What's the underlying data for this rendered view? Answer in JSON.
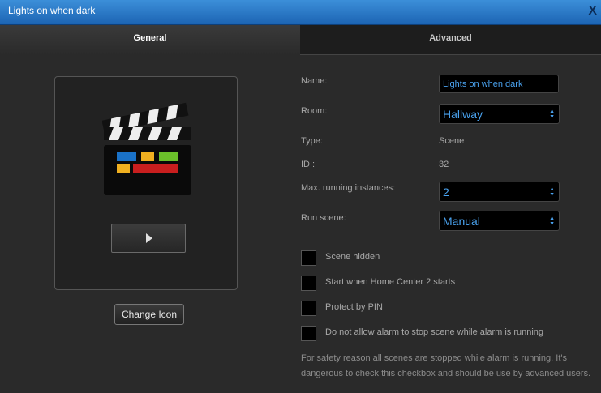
{
  "window": {
    "title": "Lights on when dark",
    "close_label": "X"
  },
  "tabs": [
    {
      "label": "General"
    },
    {
      "label": "Advanced"
    }
  ],
  "icon_panel": {
    "change_icon_label": "Change Icon"
  },
  "form": {
    "name": {
      "label": "Name:",
      "value": "Lights on when dark"
    },
    "room": {
      "label": "Room:",
      "value": "Hallway"
    },
    "type": {
      "label": "Type:",
      "value": "Scene"
    },
    "id": {
      "label": "ID :",
      "value": "32"
    },
    "max_instances": {
      "label": "Max. running instances:",
      "value": "2"
    },
    "run_scene": {
      "label": "Run scene:",
      "value": "Manual"
    }
  },
  "options": [
    {
      "label": "Scene hidden",
      "checked": false
    },
    {
      "label": "Start when Home Center 2 starts",
      "checked": false
    },
    {
      "label": "Protect by PIN",
      "checked": false
    },
    {
      "label": "Do not allow alarm to stop scene while alarm is running",
      "checked": false
    }
  ],
  "note": "For safety reason all scenes are stopped while alarm is running. It's dangerous to check this checkbox and should be use by advanced users.",
  "colors": {
    "accent_text": "#4aa3f0",
    "titlebar": "#2a7acb"
  }
}
